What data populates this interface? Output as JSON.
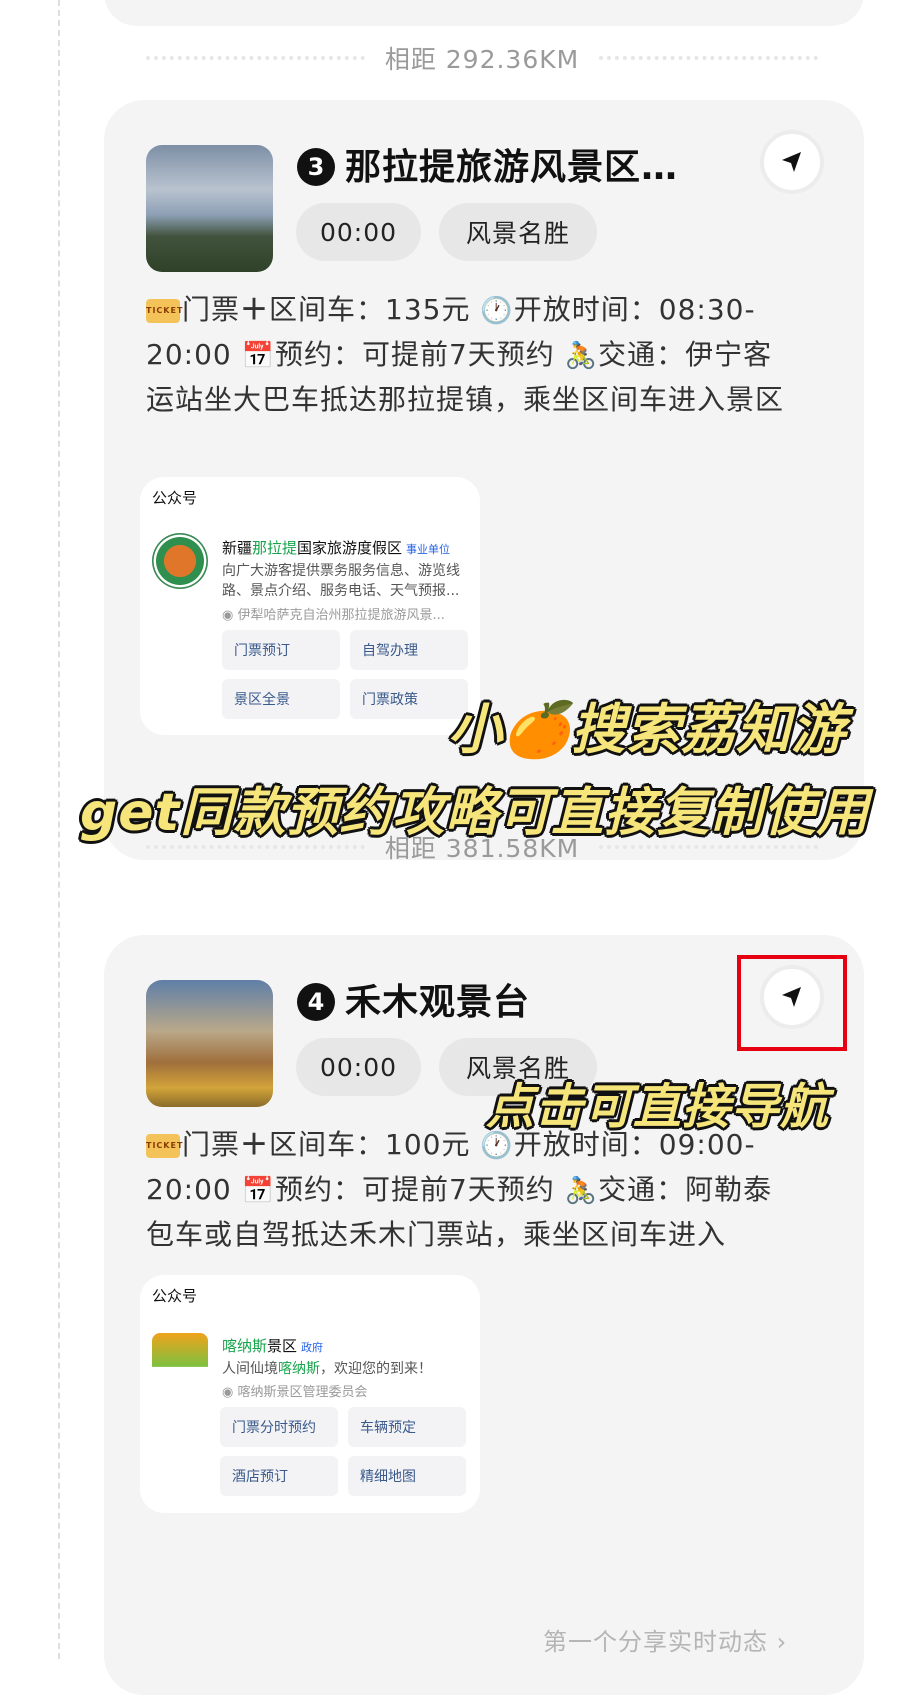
{
  "distance_3": "相距 292.36KM",
  "distance_4": "相距 381.58KM",
  "spot3": {
    "number": "3",
    "title": "那拉提旅游风景区…",
    "time_chip": "00:00",
    "category_chip": "风景名胜",
    "ticket_label": "门票",
    "plus": "＋",
    "ticket_text": "区间车：135元",
    "open_label": "开放时间：08:30-20:00",
    "reserve_label": "预约：可提前7天预约",
    "traffic_label": "交通：伊宁客运站坐大巴车抵达那拉提镇，乘坐区间车进入景区",
    "mp": {
      "label": "公众号",
      "name_pre": "新疆",
      "name_hl": "那拉提",
      "name_post": "国家旅游度假区",
      "tag": "事业单位",
      "desc": "向广大游客提供票务服务信息、游览线路、景点介绍、服务电话、天气预报...",
      "owner": "伊犁哈萨克自治州那拉提旅游风景...",
      "buttons": [
        "门票预订",
        "自驾办理",
        "景区全景",
        "门票政策"
      ]
    }
  },
  "spot4": {
    "number": "4",
    "title": "禾木观景台",
    "time_chip": "00:00",
    "category_chip": "风景名胜",
    "ticket_label": "门票",
    "plus": "＋",
    "ticket_text": "区间车：100元",
    "open_label": "开放时间：09:00-20:00",
    "reserve_label": "预约：可提前7天预约",
    "traffic_label": "交通：阿勒泰包车或自驾抵达禾木门票站，乘坐区间车进入",
    "mp": {
      "label": "公众号",
      "name_hl": "喀纳斯",
      "name_post": "景区",
      "tag": "政府",
      "desc_pre": "人间仙境",
      "desc_hl": "喀纳斯",
      "desc_post": "，欢迎您的到来！",
      "owner": "喀纳斯景区管理委员会",
      "buttons": [
        "门票分时预约",
        "车辆预定",
        "酒店预订",
        "精细地图"
      ]
    }
  },
  "overlay": {
    "line1_pre": "小",
    "line1_post": "搜索荔知游",
    "line2": "get同款预约攻略可直接复制使用",
    "line3": "点击可直接导航"
  },
  "footer_link": "第一个分享实时动态",
  "icons": {
    "nav": "navigation-arrow-icon",
    "ticket": "ticket-icon",
    "clock": "clock-icon",
    "calendar": "calendar-icon",
    "bike": "cyclist-icon",
    "orange": "tangerine-icon",
    "chevron": "chevron-right-icon",
    "verified": "verified-badge-icon"
  },
  "colors": {
    "card_bg": "#f4f4f4",
    "chip_bg": "#e7e7e7",
    "highlight_green": "#16a34a",
    "overlay_yellow": "#f6e57a",
    "annotation_red": "#e60012"
  }
}
